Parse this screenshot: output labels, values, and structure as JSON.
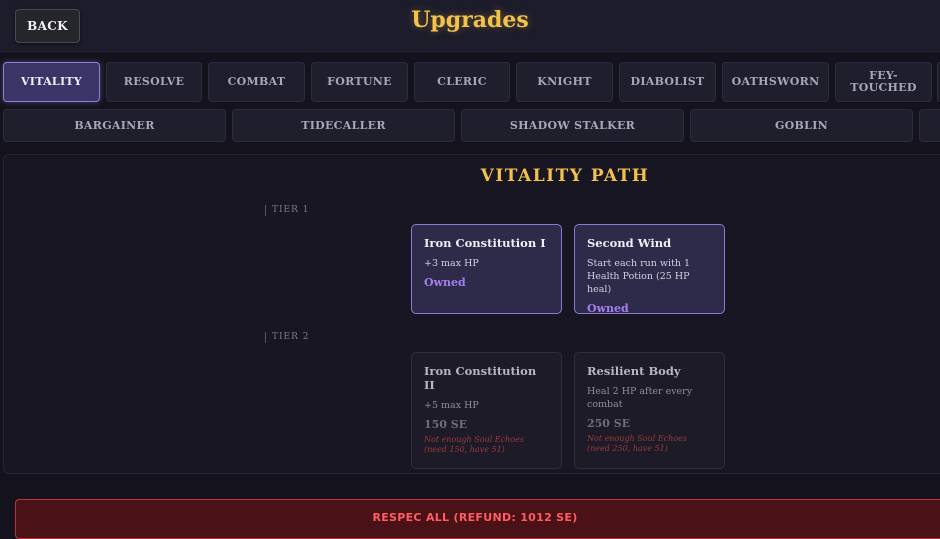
{
  "header": {
    "back_label": "BACK",
    "title": "Upgrades"
  },
  "tabs_row1": [
    {
      "label": "VITALITY",
      "active": true
    },
    {
      "label": "RESOLVE",
      "active": false
    },
    {
      "label": "COMBAT",
      "active": false
    },
    {
      "label": "FORTUNE",
      "active": false
    },
    {
      "label": "CLERIC",
      "active": false
    },
    {
      "label": "KNIGHT",
      "active": false
    },
    {
      "label": "DIABOLIST",
      "active": false
    },
    {
      "label": "OATHSWORN",
      "active": false
    },
    {
      "label": "FEY-\nTOUCHED",
      "active": false
    }
  ],
  "tabs_row2": [
    {
      "label": "BARGAINER"
    },
    {
      "label": "TIDECALLER"
    },
    {
      "label": "SHADOW STALKER"
    },
    {
      "label": "GOBLIN"
    }
  ],
  "path": {
    "title": "VITALITY PATH",
    "tiers": [
      {
        "label": "TIER 1",
        "upgrades": [
          {
            "name": "Iron Constitution I",
            "desc": "+3 max HP",
            "status": "Owned"
          },
          {
            "name": "Second Wind",
            "desc": "Start each run with 1 Health Potion (25 HP heal)",
            "status": "Owned"
          }
        ]
      },
      {
        "label": "TIER 2",
        "upgrades": [
          {
            "name": "Iron Constitution II",
            "desc": "+5 max HP",
            "cost": "150 SE",
            "warning": "Not enough Soul Echoes (need 150, have 51)"
          },
          {
            "name": "Resilient Body",
            "desc": "Heal 2 HP after every combat",
            "cost": "250 SE",
            "warning": "Not enough Soul Echoes (need 250, have 51)"
          }
        ]
      }
    ]
  },
  "respec_label": "RESPEC ALL (REFUND: 1012 SE)",
  "colors": {
    "accent_gold": "#f2c24a",
    "owned_purple": "#a57ff0",
    "danger_red": "#ff5c64"
  }
}
